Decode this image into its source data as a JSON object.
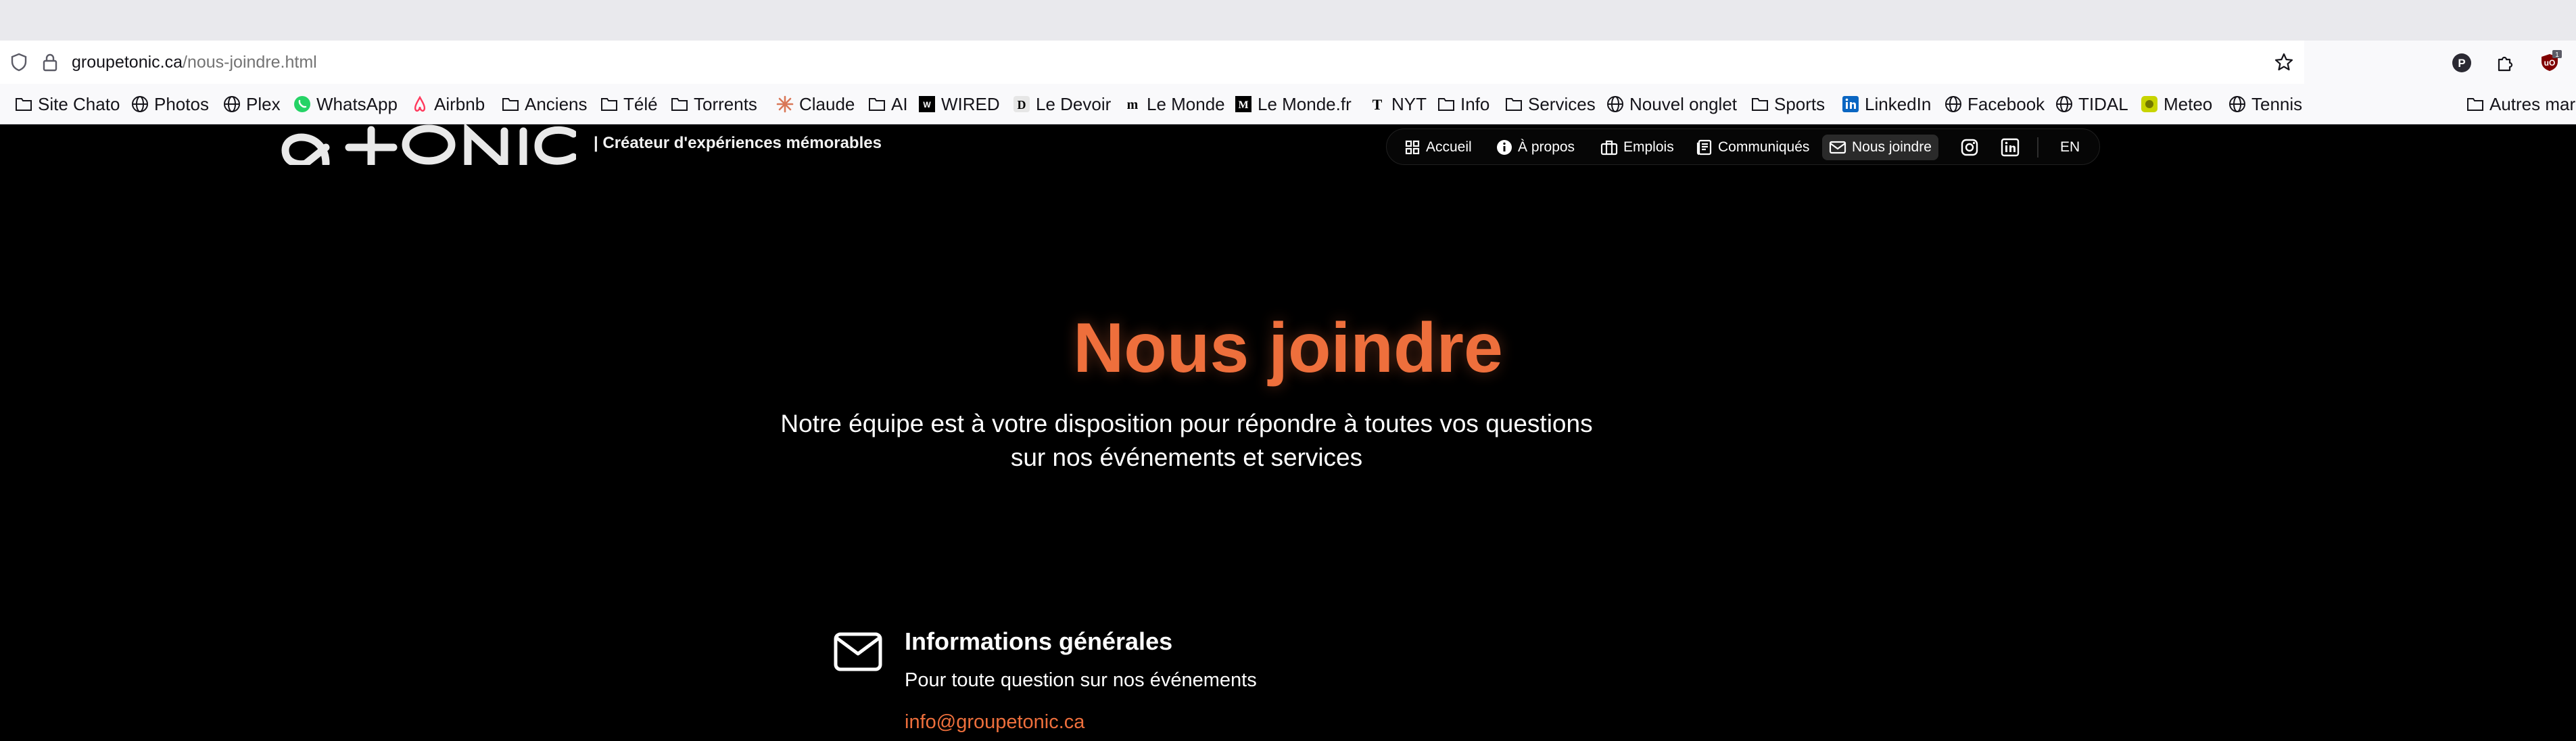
{
  "browser": {
    "url_host": "groupetonic.ca",
    "url_path": "/nous-joindre.html",
    "extension_badge": "1"
  },
  "bookmarks": [
    {
      "label": "Site Chato",
      "icon": "folder-icon"
    },
    {
      "label": "Photos",
      "icon": "globe-icon"
    },
    {
      "label": "Plex",
      "icon": "globe-icon"
    },
    {
      "label": "WhatsApp",
      "icon": "whatsapp-icon"
    },
    {
      "label": "Airbnb",
      "icon": "airbnb-icon"
    },
    {
      "label": "Anciens",
      "icon": "folder-icon"
    },
    {
      "label": "Télé",
      "icon": "folder-icon"
    },
    {
      "label": "Torrents",
      "icon": "folder-icon"
    },
    {
      "label": "Claude",
      "icon": "claude-icon"
    },
    {
      "label": "AI",
      "icon": "folder-icon"
    },
    {
      "label": "WIRED",
      "icon": "wired-icon"
    },
    {
      "label": "Le Devoir",
      "icon": "le-devoir-icon"
    },
    {
      "label": "Le Monde",
      "icon": "le-monde-icon"
    },
    {
      "label": "Le Monde.fr",
      "icon": "le-monde-fr-icon"
    },
    {
      "label": "NYT",
      "icon": "nyt-icon"
    },
    {
      "label": "Info",
      "icon": "folder-icon"
    },
    {
      "label": "Services",
      "icon": "folder-icon"
    },
    {
      "label": "Nouvel onglet",
      "icon": "globe-icon"
    },
    {
      "label": "Sports",
      "icon": "folder-icon"
    },
    {
      "label": "LinkedIn",
      "icon": "linkedin-icon"
    },
    {
      "label": "Facebook",
      "icon": "globe-icon"
    },
    {
      "label": "TIDAL",
      "icon": "globe-icon"
    },
    {
      "label": "Meteo",
      "icon": "meteo-icon"
    },
    {
      "label": "Tennis",
      "icon": "globe-icon"
    }
  ],
  "bookmarks_overflow": "Autres mar",
  "site": {
    "tagline": "| Créateur d'expériences mémorables",
    "nav": [
      {
        "label": "Accueil",
        "icon": "grid-icon"
      },
      {
        "label": "À propos",
        "icon": "info-icon"
      },
      {
        "label": "Emplois",
        "icon": "briefcase-icon"
      },
      {
        "label": "Communiqués",
        "icon": "newspaper-icon"
      },
      {
        "label": "Nous joindre",
        "icon": "mail-icon",
        "active": true
      }
    ],
    "lang_toggle": "EN"
  },
  "hero": {
    "title": "Nous joindre",
    "subtitle_line1": "Notre équipe est à votre disposition pour répondre à toutes vos questions",
    "subtitle_line2": "sur nos événements et services"
  },
  "contact": {
    "title": "Informations générales",
    "description": "Pour toute question sur nos événements",
    "email": "info@groupetonic.ca"
  },
  "colors": {
    "accent": "#ee6f3c",
    "page_bg": "#000000",
    "chrome_bg": "#f9f9fb",
    "tabstrip_bg": "#e9e9ed"
  }
}
